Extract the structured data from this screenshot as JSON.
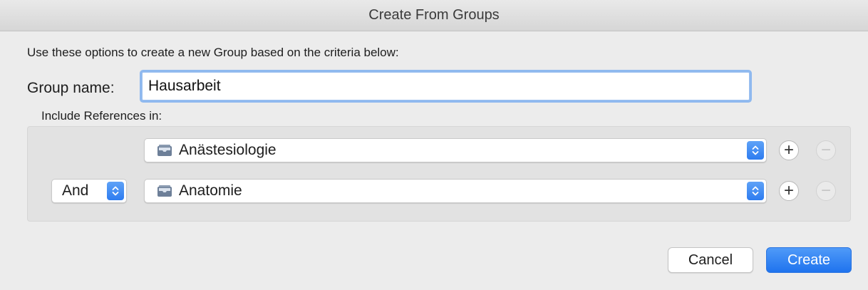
{
  "window": {
    "title": "Create From Groups"
  },
  "dialog": {
    "description": "Use these options to create a new Group based on the criteria below:",
    "group_name_label": "Group name:",
    "group_name_value": "Hausarbeit",
    "include_label": "Include References in:"
  },
  "criteria": [
    {
      "operator": null,
      "group": "Anästesiologie",
      "icon": "folder-icon"
    },
    {
      "operator": "And",
      "group": "Anatomie",
      "icon": "folder-icon"
    }
  ],
  "buttons": {
    "cancel": "Cancel",
    "create": "Create",
    "add": "+",
    "remove": "−"
  },
  "colors": {
    "accent": "#2d7cf0",
    "focus_ring": "#8fb9ef",
    "background": "#ececec"
  }
}
